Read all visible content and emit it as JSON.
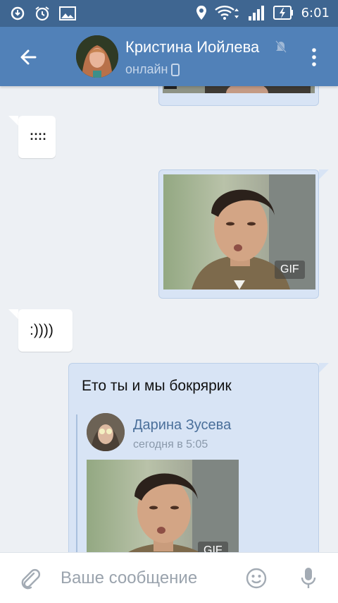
{
  "statusbar": {
    "time": "6:01",
    "icons": [
      "sync-icon",
      "alarm-icon",
      "image-icon",
      "location-icon",
      "wifi-icon",
      "signal-icon",
      "battery-charging-icon"
    ]
  },
  "header": {
    "name": "Кристина Иойлева",
    "status": "онлайн",
    "icons": [
      "back-arrow-icon",
      "muted-icon",
      "mobile-icon",
      "more-vert-icon"
    ]
  },
  "messages": [
    {
      "direction": "in",
      "text": "::::"
    },
    {
      "direction": "out",
      "type": "gif",
      "badge": "GIF"
    },
    {
      "direction": "in",
      "text": ":))))"
    },
    {
      "direction": "out",
      "text": "Ето ты и мы бокрярик",
      "forwarded": {
        "author": "Дарина Зусева",
        "date": "сегодня в 5:05",
        "badge": "GIF"
      }
    }
  ],
  "composer": {
    "placeholder": "Ваше сообщение",
    "value": ""
  },
  "colors": {
    "header": "#5181b8",
    "statusbar": "#3f6691",
    "bubble_out": "#d8e4f5",
    "bubble_in": "#ffffff",
    "link": "#4a6f9a"
  }
}
